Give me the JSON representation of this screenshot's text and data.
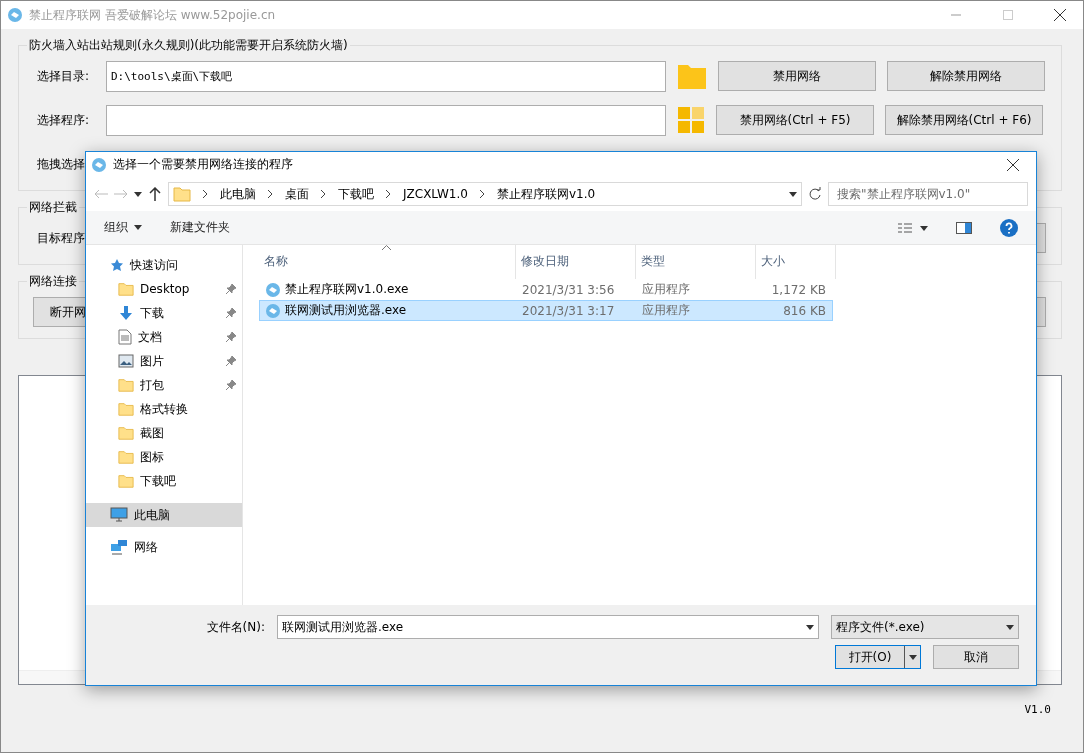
{
  "window": {
    "title": "禁止程序联网 吾爱破解论坛 www.52pojie.cn"
  },
  "firewall_group": {
    "title": "防火墙入站出站规则(永久规则)(此功能需要开启系统防火墙)",
    "rows": [
      {
        "label": "选择目录:",
        "value": "D:\\tools\\桌面\\下载吧",
        "kind": "folder",
        "buttons": [
          "禁用网络",
          "解除禁用网络"
        ]
      },
      {
        "label": "选择程序:",
        "kind": "grid",
        "buttons": [
          "禁用网络(Ctrl + F5)",
          "解除禁用网络(Ctrl + F6)"
        ]
      }
    ],
    "drag_label": "拖拽选择"
  },
  "intercept_group": {
    "title": "网络拦截",
    "label": "目标程序"
  },
  "connection_group": {
    "title": "网络连接",
    "button": "断开网"
  },
  "version": "V1.0",
  "dialog": {
    "title": "选择一个需要禁用网络连接的程序",
    "breadcrumb": [
      "此电脑",
      "桌面",
      "下载吧",
      "JZCXLW1.0",
      "禁止程序联网v1.0"
    ],
    "search": {
      "placeholder": "搜索\"禁止程序联网v1.0\""
    },
    "toolbar": [
      {
        "label": "组织",
        "kind": "menu"
      },
      {
        "label": "新建文件夹",
        "kind": "plain"
      }
    ],
    "nav": [
      {
        "label": "快速访问",
        "kind": "star",
        "pinned": false,
        "selected": false
      },
      {
        "label": "Desktop",
        "kind": "folder",
        "pinned": true,
        "selected": false
      },
      {
        "label": "下载",
        "kind": "download",
        "pinned": true,
        "selected": false
      },
      {
        "label": "文档",
        "kind": "document",
        "pinned": true,
        "selected": false
      },
      {
        "label": "图片",
        "kind": "image",
        "pinned": true,
        "selected": false
      },
      {
        "label": "打包",
        "kind": "folder",
        "pinned": true,
        "selected": false
      },
      {
        "label": "格式转换",
        "kind": "folder",
        "pinned": false,
        "selected": false
      },
      {
        "label": "截图",
        "kind": "folder",
        "pinned": false,
        "selected": false
      },
      {
        "label": "图标",
        "kind": "folder",
        "pinned": false,
        "selected": false
      },
      {
        "label": "下载吧",
        "kind": "folder",
        "pinned": false,
        "selected": false
      },
      {
        "label": "此电脑",
        "kind": "computer",
        "pinned": false,
        "selected": true
      },
      {
        "label": "网络",
        "kind": "network",
        "pinned": false,
        "selected": false
      }
    ],
    "columns": [
      "名称",
      "修改日期",
      "类型",
      "大小"
    ],
    "files": [
      {
        "name": "禁止程序联网v1.0.exe",
        "date": "2021/3/31 3:56",
        "type": "应用程序",
        "size": "1,172 KB",
        "selected": false
      },
      {
        "name": "联网测试用浏览器.exe",
        "date": "2021/3/31 3:17",
        "type": "应用程序",
        "size": "816 KB",
        "selected": true
      }
    ],
    "filename_label": "文件名(N):",
    "filename": "联网测试用浏览器.exe",
    "filetype": "程序文件(*.exe)",
    "open": "打开(O)",
    "cancel": "取消"
  }
}
